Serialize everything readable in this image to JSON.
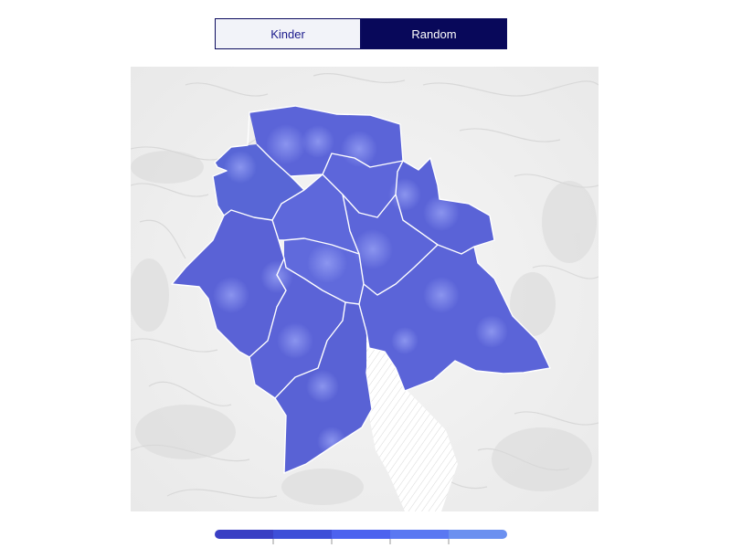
{
  "toggle": {
    "options": [
      {
        "label": "Kinder",
        "selected": false
      },
      {
        "label": "Random",
        "selected": true
      }
    ]
  },
  "map": {
    "districts": [
      {
        "id": "district-north-west"
      },
      {
        "id": "district-north"
      },
      {
        "id": "district-north-east"
      },
      {
        "id": "district-east-center"
      },
      {
        "id": "district-center-north"
      },
      {
        "id": "district-west"
      },
      {
        "id": "district-center-west"
      },
      {
        "id": "district-center"
      },
      {
        "id": "district-south-west"
      },
      {
        "id": "district-south"
      },
      {
        "id": "district-south-east"
      },
      {
        "id": "district-east"
      }
    ],
    "colors": {
      "fill": "#5b64d8",
      "highlight": "#8c97f2",
      "border": "#ffffff",
      "terrain": "#e7e7e7",
      "lake_hatch": "#d8d8d8"
    }
  },
  "legend": {
    "colors": [
      "#3a3fc4",
      "#3e4fd8",
      "#4c62ef",
      "#5a78f2",
      "#6b90f0"
    ],
    "tick_count": 4
  }
}
